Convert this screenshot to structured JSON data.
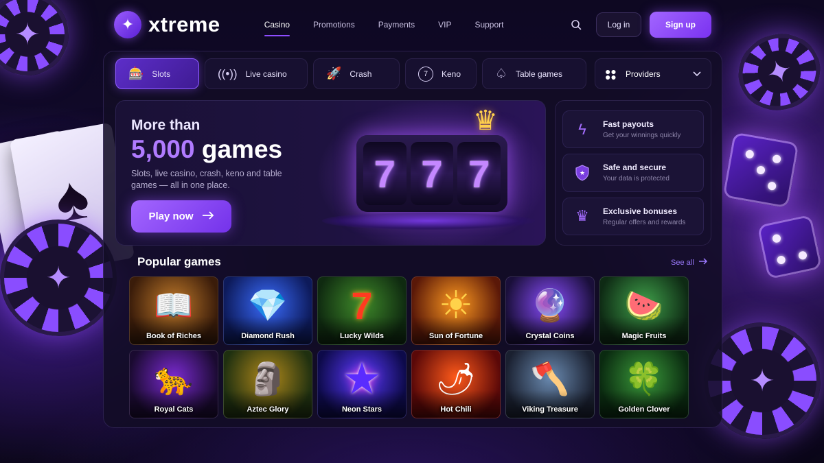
{
  "brand": {
    "logo_text": "xtreme",
    "logo_icon": "star-icon"
  },
  "nav": {
    "items": [
      {
        "label": "Casino",
        "active": true
      },
      {
        "label": "Promotions"
      },
      {
        "label": "Payments"
      },
      {
        "label": "VIP"
      },
      {
        "label": "Support"
      }
    ],
    "search_icon": "search-icon",
    "login_label": "Log in",
    "signup_label": "Sign up"
  },
  "tabs": [
    {
      "label": "Slots",
      "icon": "slot-machine-icon",
      "active": true
    },
    {
      "label": "Live casino",
      "icon": "broadcast-icon"
    },
    {
      "label": "Crash",
      "icon": "rocket-icon"
    },
    {
      "label": "Keno",
      "icon": "keno-ball-icon",
      "icon_text": "7"
    },
    {
      "label": "Table games",
      "icon": "spade-icon"
    }
  ],
  "providers": {
    "label": "Providers",
    "icon": "grid-dots-icon"
  },
  "hero": {
    "line1": "More than",
    "count": "5,000",
    "games_word": " games",
    "description": "Slots, live casino, crash, keno and table games — all in one place.",
    "cta": "Play now",
    "reels": [
      "7",
      "7",
      "7"
    ]
  },
  "features": [
    {
      "title": "Fast payouts",
      "subtitle": "Get your winnings quickly",
      "icon": "lightning-icon"
    },
    {
      "title": "Safe and secure",
      "subtitle": "Your data is protected",
      "icon": "shield-icon"
    },
    {
      "title": "Exclusive bonuses",
      "subtitle": "Regular offers and rewards",
      "icon": "crown-icon"
    }
  ],
  "popular": {
    "title": "Popular games",
    "see_all": "See all",
    "games": [
      {
        "name": "Book of Riches",
        "art": "📖"
      },
      {
        "name": "Diamond Rush",
        "art": "💎"
      },
      {
        "name": "Lucky Wilds",
        "art": "7"
      },
      {
        "name": "Sun of Fortune",
        "art": "☀"
      },
      {
        "name": "Crystal Coins",
        "art": "🔮"
      },
      {
        "name": "Magic Fruits",
        "art": "🍉"
      },
      {
        "name": "Royal Cats",
        "art": "🐆"
      },
      {
        "name": "Aztec Glory",
        "art": "🗿"
      },
      {
        "name": "Neon Stars",
        "art": "★"
      },
      {
        "name": "Hot Chili",
        "art": "🌶"
      },
      {
        "name": "Viking Treasure",
        "art": "🪓"
      },
      {
        "name": "Golden Clover",
        "art": "🍀"
      }
    ]
  },
  "colors": {
    "accent": "#8e4dff",
    "background": "#0e0822"
  }
}
